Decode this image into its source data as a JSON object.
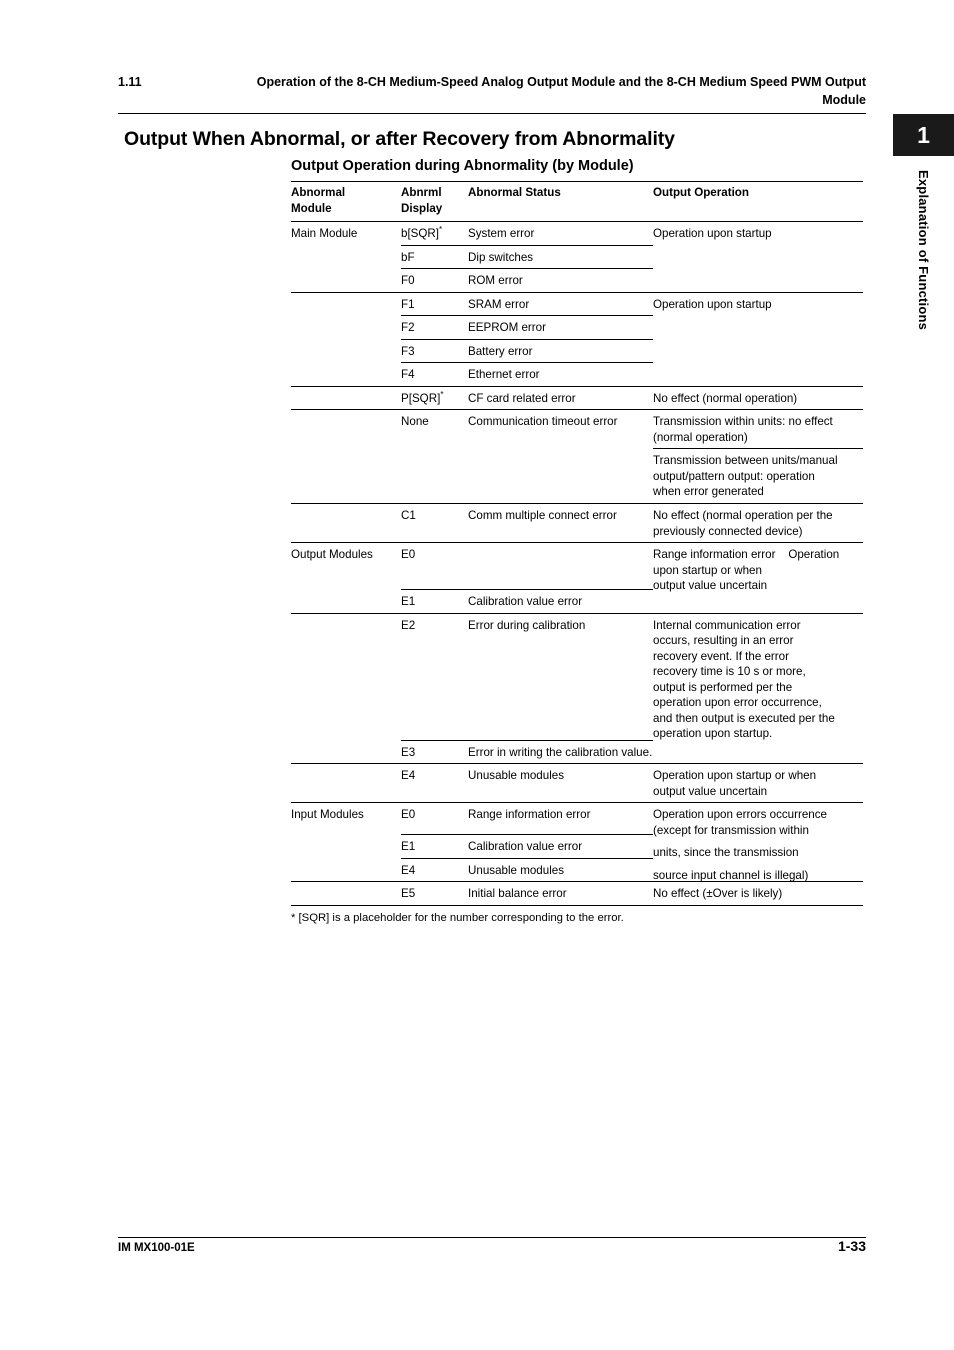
{
  "running_head": {
    "number": "1.11",
    "title": "Operation of the 8-CH Medium-Speed Analog Output Module and the 8-CH Medium Speed PWM Output",
    "title_line2": "Module"
  },
  "chapter_tab": {
    "number": "1",
    "label": "Explanation of Functions"
  },
  "section_title": "Output When Abnormal, or after Recovery from Abnormality",
  "table_title": "Output Operation during Abnormality (by Module)",
  "table": {
    "headers": {
      "module": "Abnormal Module",
      "module_l1": "Abnormal",
      "module_l2": "Module",
      "display_l1": "Abnrml",
      "display_l2": "Display",
      "status": "Abnormal Status",
      "output": "Output Operation"
    },
    "groups": [
      {
        "module": "Main Module",
        "rows": [
          {
            "display": "b[SQR]",
            "sup": "*",
            "status": "System error",
            "output": "Operation upon startup"
          },
          {
            "display": "bF",
            "sup": "",
            "status": "Dip switches",
            "output": ""
          },
          {
            "display": "F0",
            "sup": "",
            "status": "ROM error",
            "output": ""
          },
          {
            "display": "F1",
            "sup": "",
            "status": "SRAM error",
            "output": "Operation upon startup"
          },
          {
            "display": "F2",
            "sup": "",
            "status": "EEPROM error",
            "output": ""
          },
          {
            "display": "F3",
            "sup": "",
            "status": "Battery error",
            "output": ""
          },
          {
            "display": "F4",
            "sup": "",
            "status": "Ethernet error",
            "output": ""
          },
          {
            "display": "P[SQR]",
            "sup": "*",
            "status": "CF card related error",
            "output": "No effect (normal operation)"
          },
          {
            "display": "None",
            "sup": "",
            "status": "Communication timeout error",
            "output": "Transmission within units: no effect (normal operation)"
          },
          {
            "display": "",
            "sup": "",
            "status": "",
            "output": "Transmission between units/manual output/pattern output: operation when error generated"
          },
          {
            "display": "C1",
            "sup": "",
            "status": "Comm multiple connect error",
            "output": "No effect (normal operation per the previously connected device)"
          }
        ]
      },
      {
        "module": "Output Modules",
        "rows": [
          {
            "display": "E0",
            "sup": "",
            "status": "",
            "output": "Range information error    Operation upon startup or when output value uncertain"
          },
          {
            "display": "E1",
            "sup": "",
            "status": "Calibration value error",
            "output": ""
          },
          {
            "display": "E2",
            "sup": "",
            "status": "Error during calibration",
            "output": "Internal communication error occurs, resulting in an error recovery event. If the error recovery time is 10 s or more, output is performed per the operation upon error occurrence, and then output is executed per the operation upon startup."
          },
          {
            "display": "E3",
            "sup": "",
            "status": "Error in writing the calibration value.",
            "output": ""
          },
          {
            "display": "E4",
            "sup": "",
            "status": "Unusable modules",
            "output": "Operation upon startup or when output value uncertain"
          }
        ]
      },
      {
        "module": "Input Modules",
        "rows": [
          {
            "display": "E0",
            "sup": "",
            "status": "Range information error",
            "output": "Operation upon errors occurrence (except for transmission within units, since the transmission source input channel is illegal)"
          },
          {
            "display": "E1",
            "sup": "",
            "status": "Calibration value error",
            "output": ""
          },
          {
            "display": "E4",
            "sup": "",
            "status": "Unusable modules",
            "output": ""
          },
          {
            "display": "E5",
            "sup": "",
            "status": "Initial balance error",
            "output": "No effect (±Over is likely)"
          }
        ]
      }
    ],
    "output_fragments": {
      "main_startup_1": "Operation upon startup",
      "main_startup_2": "Operation upon startup",
      "cf_card": "No effect (normal operation)",
      "timeout_a1": "Transmission within units: no effect",
      "timeout_a2": "(normal operation)",
      "timeout_b1": "Transmission between units/manual",
      "timeout_b2": "output/pattern output: operation",
      "timeout_b3": "when error generated",
      "c1_1": "No effect (normal operation per the",
      "c1_2": "previously connected device)",
      "out_e0_1": "Range information error    Operation",
      "out_e0_2": "upon startup or when",
      "out_e0_3": "output value uncertain",
      "out_e2_1": "Internal communication error",
      "out_e2_2": "occurs, resulting in an error",
      "out_e2_3": "recovery event. If the error",
      "out_e2_4": "recovery time is 10 s or more,",
      "out_e2_5": "output is performed per the",
      "out_e2_6": "operation upon error occurrence,",
      "out_e2_7": "and then output is executed per the",
      "out_e2_8": "operation upon startup.",
      "out_e4_1": "Operation upon startup or when",
      "out_e4_2": "output value uncertain",
      "in_e0_1": "Operation upon errors occurrence",
      "in_e0_2": "(except for transmission within",
      "in_e0_3": "units, since the transmission",
      "in_e0_4": "source input channel is illegal)",
      "in_e5": "No effect (±Over is likely)"
    }
  },
  "footnote": "* [SQR] is a placeholder for the number corresponding to the error.",
  "footer": {
    "left": "IM MX100-01E",
    "page": "1-33"
  }
}
